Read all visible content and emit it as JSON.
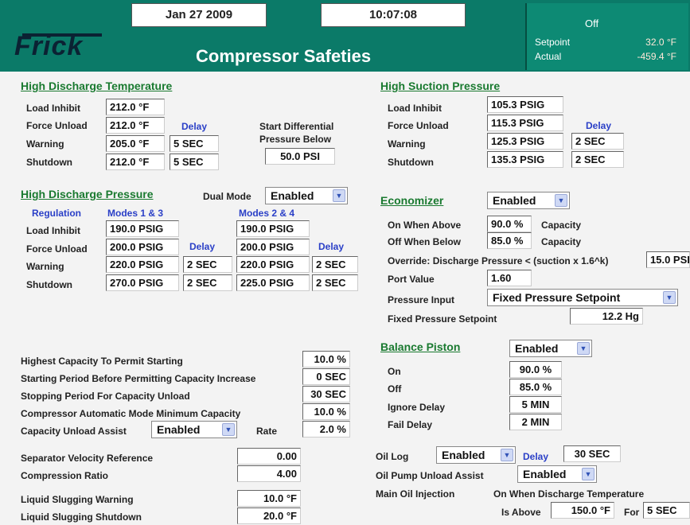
{
  "header": {
    "date": "Jan 27 2009",
    "time": "10:07:08",
    "logo": "Frick",
    "title": "Compressor Safeties",
    "status": "Off",
    "setpoint_label": "Setpoint",
    "setpoint_value": "32.0 °F",
    "actual_label": "Actual",
    "actual_value": "-459.4 °F"
  },
  "hdt": {
    "title": "High Discharge Temperature",
    "load_inhibit_label": "Load Inhibit",
    "load_inhibit": "212.0 °F",
    "force_unload_label": "Force Unload",
    "force_unload": "212.0 °F",
    "warning_label": "Warning",
    "warning": "205.0 °F",
    "shutdown_label": "Shutdown",
    "shutdown": "212.0 °F",
    "delay_label": "Delay",
    "warning_delay": "5 SEC",
    "shutdown_delay": "5 SEC",
    "sd_label_1": "Start Differential",
    "sd_label_2": "Pressure Below",
    "sd_value": "50.0 PSI"
  },
  "hsp": {
    "title": "High Suction Pressure",
    "load_inhibit_label": "Load Inhibit",
    "load_inhibit": "105.3 PSIG",
    "force_unload_label": "Force Unload",
    "force_unload": "115.3 PSIG",
    "warning_label": "Warning",
    "warning": "125.3 PSIG",
    "shutdown_label": "Shutdown",
    "shutdown": "135.3 PSIG",
    "delay_label": "Delay",
    "warning_delay": "2 SEC",
    "shutdown_delay": "2 SEC"
  },
  "hdp": {
    "title": "High Discharge Pressure",
    "dual_mode_label": "Dual Mode",
    "dual_mode": "Enabled",
    "regulation_label": "Regulation",
    "modes13_label": "Modes 1 & 3",
    "modes24_label": "Modes 2 & 4",
    "load_inhibit_label": "Load Inhibit",
    "force_unload_label": "Force Unload",
    "warning_label": "Warning",
    "shutdown_label": "Shutdown",
    "delay_label": "Delay",
    "m13": {
      "load_inhibit": "190.0 PSIG",
      "force_unload": "200.0 PSIG",
      "warning": "220.0 PSIG",
      "shutdown": "270.0 PSIG",
      "warning_delay": "2 SEC",
      "shutdown_delay": "2 SEC"
    },
    "m24": {
      "load_inhibit": "190.0 PSIG",
      "force_unload": "200.0 PSIG",
      "warning": "220.0 PSIG",
      "shutdown": "225.0 PSIG",
      "warning_delay": "2 SEC",
      "shutdown_delay": "2 SEC"
    }
  },
  "econ": {
    "title": "Economizer",
    "state": "Enabled",
    "on_above_label": "On When Above",
    "on_above": "90.0 %",
    "off_below_label": "Off When Below",
    "off_below": "85.0 %",
    "capacity_label": "Capacity",
    "override_label": "Override: Discharge Pressure < (suction x 1.6^k)",
    "override_value": "15.0 PSI",
    "port_value_label": "Port Value",
    "port_value": "1.60",
    "pressure_input_label": "Pressure Input",
    "pressure_input": "Fixed Pressure Setpoint",
    "fixed_setpoint_label": "Fixed Pressure Setpoint",
    "fixed_setpoint": "12.2 Hg"
  },
  "capacity": {
    "highest_label": "Highest Capacity To Permit Starting",
    "highest": "10.0 %",
    "starting_label": "Starting Period Before Permitting Capacity Increase",
    "starting": "0 SEC",
    "stopping_label": "Stopping Period For Capacity Unload",
    "stopping": "30 SEC",
    "auto_min_label": "Compressor Automatic Mode Minimum Capacity",
    "auto_min": "10.0 %",
    "unload_assist_label": "Capacity Unload Assist",
    "unload_assist": "Enabled",
    "rate_label": "Rate",
    "rate": "2.0 %"
  },
  "separator": {
    "velocity_label": "Separator Velocity Reference",
    "velocity": "0.00",
    "compression_label": "Compression Ratio",
    "compression": "4.00"
  },
  "slugging": {
    "warning_label": "Liquid Slugging Warning",
    "warning": "10.0 °F",
    "shutdown_label": "Liquid Slugging Shutdown",
    "shutdown": "20.0 °F"
  },
  "balance": {
    "title": "Balance Piston",
    "state": "Enabled",
    "on_label": "On",
    "on": "90.0 %",
    "off_label": "Off",
    "off": "85.0 %",
    "ignore_label": "Ignore Delay",
    "ignore": "5 MIN",
    "fail_label": "Fail Delay",
    "fail": "2 MIN"
  },
  "oil": {
    "log_label": "Oil Log",
    "log_state": "Enabled",
    "delay_label": "Delay",
    "log_delay": "30 SEC",
    "pump_label": "Oil Pump Unload Assist",
    "pump_state": "Enabled",
    "injection_label": "Main Oil Injection",
    "injection_desc": "On When Discharge Temperature",
    "is_above_label": "Is Above",
    "is_above": "150.0 °F",
    "for_label": "For",
    "for_value": "5 SEC"
  }
}
